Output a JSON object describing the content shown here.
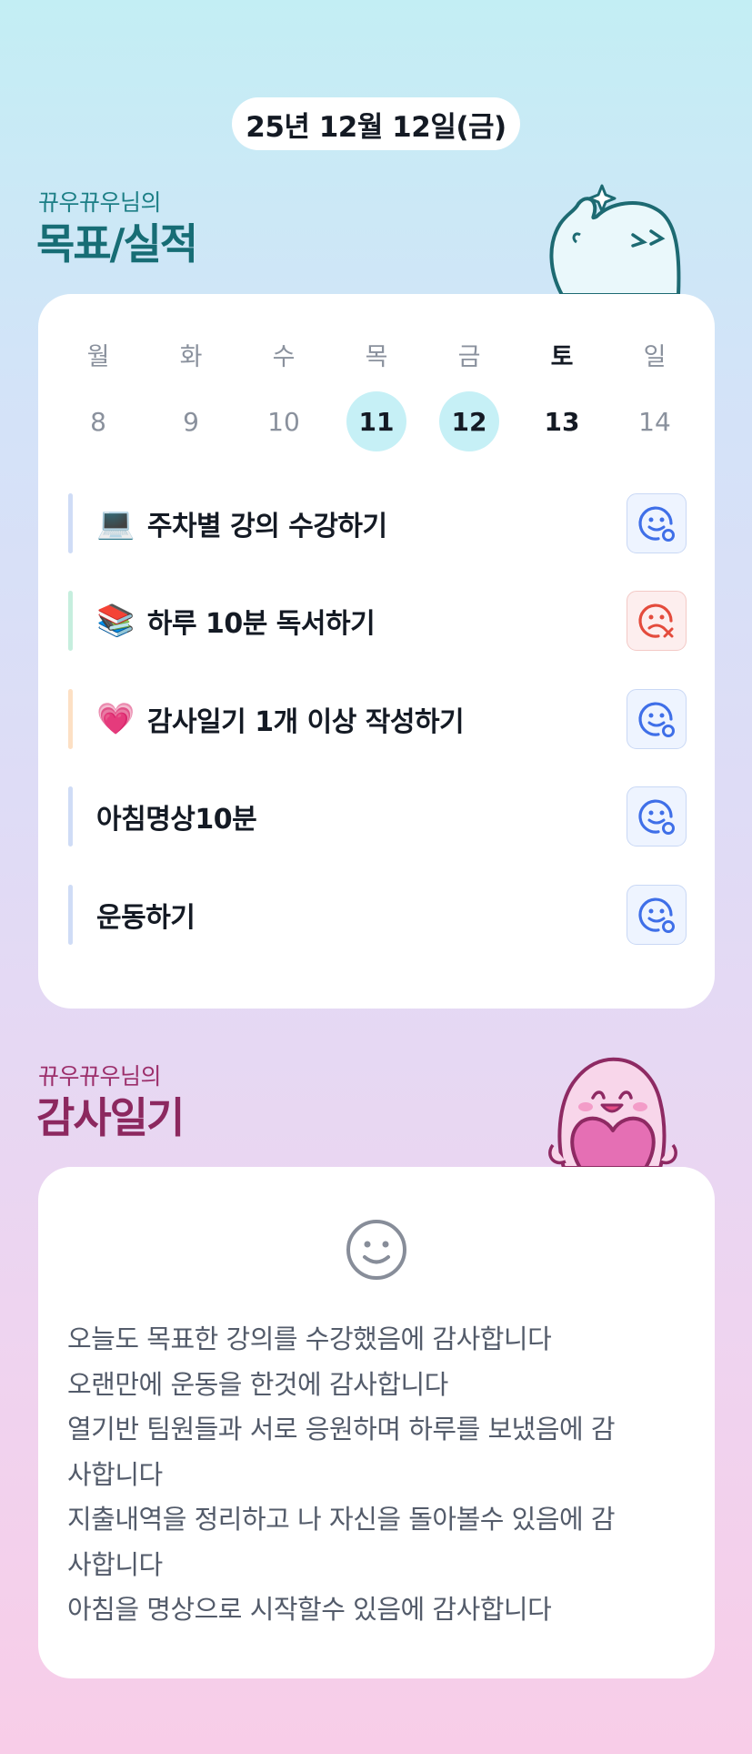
{
  "date": "25년 12월 12일(금)",
  "goal_section": {
    "subtitle": "뀨우뀨우님의",
    "title": "목표/실적"
  },
  "week": {
    "days": [
      {
        "name": "월",
        "num": "8",
        "state": "normal"
      },
      {
        "name": "화",
        "num": "9",
        "state": "normal"
      },
      {
        "name": "수",
        "num": "10",
        "state": "normal"
      },
      {
        "name": "목",
        "num": "11",
        "state": "done"
      },
      {
        "name": "금",
        "num": "12",
        "state": "done"
      },
      {
        "name": "토",
        "num": "13",
        "state": "today"
      },
      {
        "name": "일",
        "num": "14",
        "state": "normal"
      }
    ]
  },
  "goals": [
    {
      "emoji": "💻",
      "label": "주차별 강의 수강하기",
      "status": "success",
      "bar_color": "#cfdcf6"
    },
    {
      "emoji": "📚",
      "label": "하루 10분 독서하기",
      "status": "fail",
      "bar_color": "#c6eede"
    },
    {
      "emoji": "💗",
      "label": "감사일기 1개 이상 작성하기",
      "status": "success",
      "bar_color": "#fde0c4"
    },
    {
      "emoji": "",
      "label": "아침명상10분",
      "status": "success",
      "bar_color": "#cfdcf6"
    },
    {
      "emoji": "",
      "label": "운동하기",
      "status": "success",
      "bar_color": "#cfdcf6"
    }
  ],
  "diary_section": {
    "subtitle": "뀨우뀨우님의",
    "title": "감사일기"
  },
  "diary_lines": [
    "오늘도 목표한 강의를 수강했음에 감사합니다",
    "오랜만에 운동을 한것에 감사합니다",
    "열기반 팀원들과 서로 응원하며 하루를 보냈음에 감",
    "사합니다",
    "지출내역을 정리하고 나 자신을 돌아볼수 있음에 감",
    "사합니다",
    "아침을 명상으로 시작할수 있음에 감사합니다"
  ],
  "icons": {
    "success": "smile-check-icon",
    "fail": "sad-x-icon",
    "diary": "smiley-icon"
  },
  "colors": {
    "success_icon": "#3f6fe8",
    "fail_icon": "#e44b3c",
    "done_day": "#c6f0f6"
  }
}
